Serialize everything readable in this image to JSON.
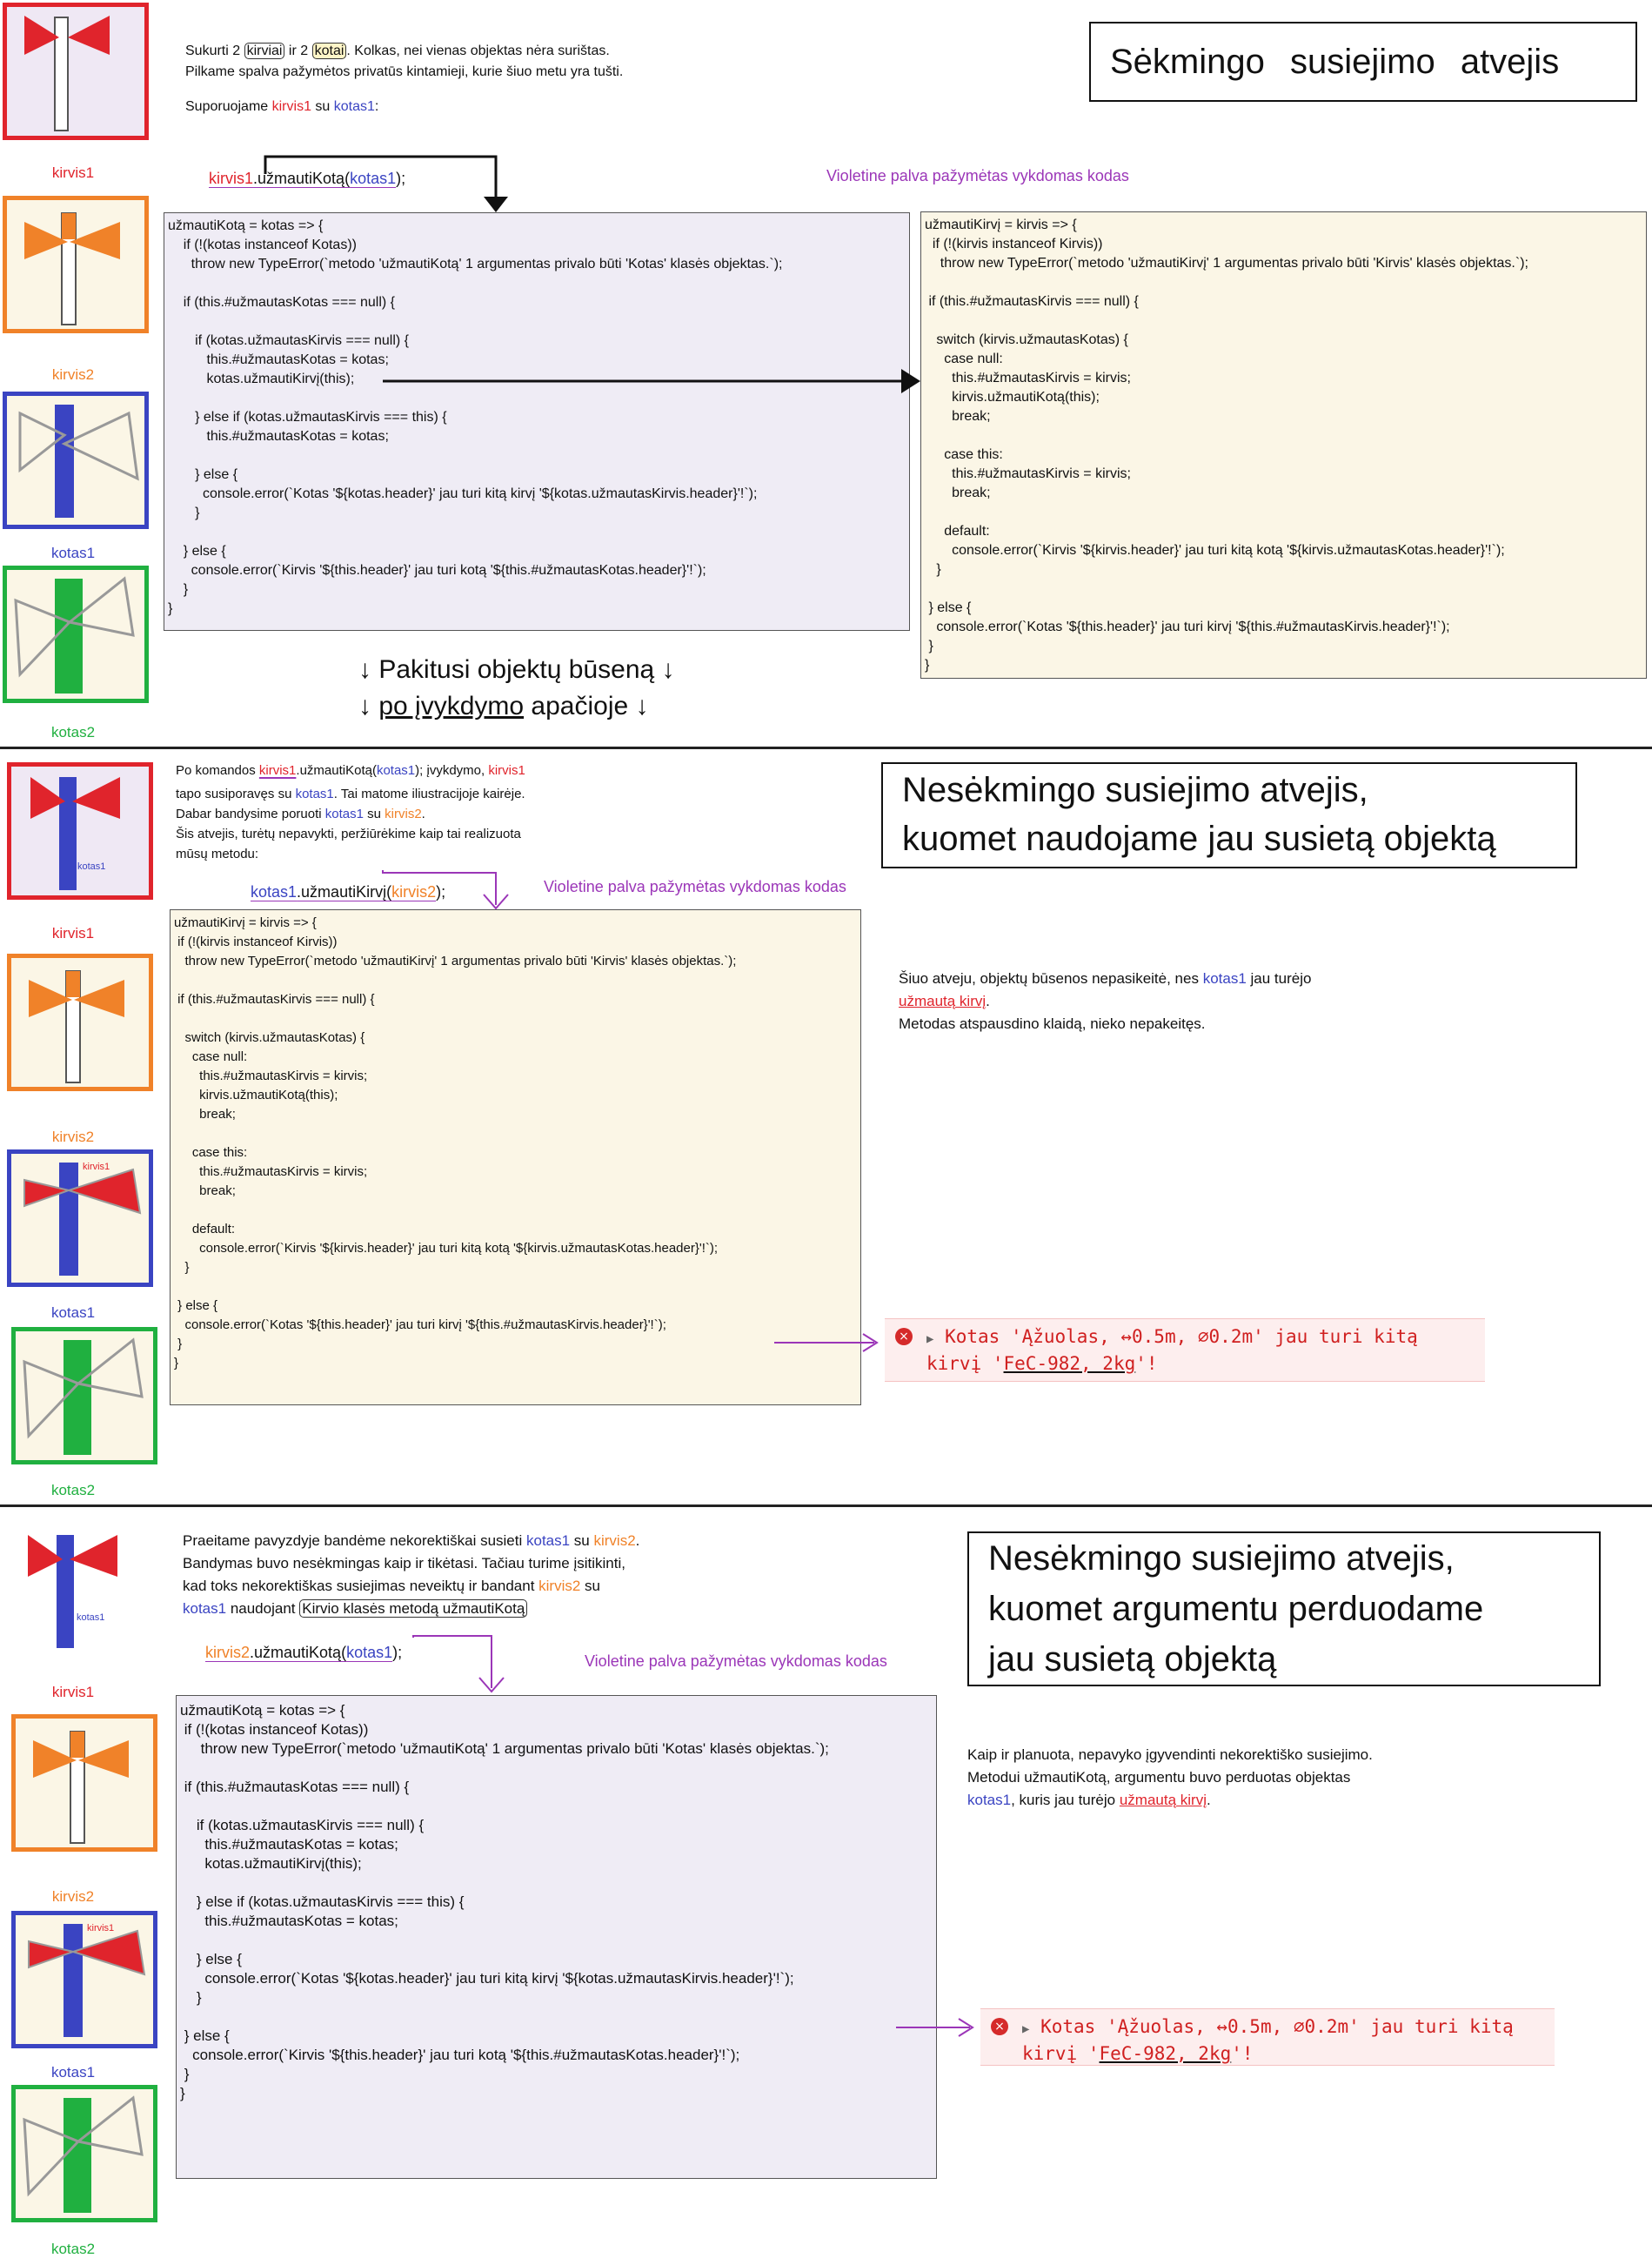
{
  "objects": {
    "kirvis1": "kirvis1",
    "kirvis2": "kirvis2",
    "kotas1": "kotas1",
    "kotas2": "kotas2",
    "inner_kotas1": "kotas1",
    "inner_kirvis1": "kirvis1"
  },
  "colors": {
    "red": "#e0242c",
    "orange": "#f08229",
    "blue": "#3a44c2",
    "green": "#20b040",
    "purple": "#9b36b8"
  },
  "s1": {
    "title": "Sėkmingo susiejimo atvejis",
    "intro": {
      "l1a": "Sukurti 2 ",
      "l1b": "kirviai",
      "l1c": " ir 2 ",
      "l1d": "kotai",
      "l1e": ". Kolkas, nei vienas objektas nėra surištas.",
      "l2": "Pilkame spalva pažymėtos privatūs kintamieji, kurie šiuo metu yra tušti.",
      "l3a": "Suporuojame ",
      "l3b": "kirvis1",
      "l3c": " su ",
      "l3d": "kotas1",
      "l3e": ":"
    },
    "call": {
      "a": "kirvis1",
      "b": ".užmautiKotą(",
      "c": "kotas1",
      "d": ");"
    },
    "note": "Violetine palva pažymėtas vykdomas kodas",
    "code_left": [
      "užmautiKotą = kotas => {",
      "    if (!(kotas instanceof Kotas))",
      "      throw new TypeError(`metodo 'užmautiKotą' 1 argumentas privalo būti 'Kotas' klasės objektas.`);",
      "",
      "    if (this.#užmautasKotas === null) {",
      "",
      "       if (kotas.užmautasKirvis === null) {",
      "          this.#užmautasKotas = kotas;",
      "          kotas.užmautiKirvį(this);",
      "",
      "       } else if (kotas.užmautasKirvis === this) {",
      "          this.#užmautasKotas = kotas;",
      "",
      "       } else {",
      "         console.error(`Kotas '${kotas.header}' jau turi kitą kirvį '${kotas.užmautasKirvis.header}'!`);",
      "       }",
      "",
      "    } else {",
      "      console.error(`Kirvis '${this.header}' jau turi kotą '${this.#užmautasKotas.header}'!`);",
      "    }",
      "}"
    ],
    "code_right": [
      "užmautiKirvį = kirvis => {",
      "  if (!(kirvis instanceof Kirvis))",
      "    throw new TypeError(`metodo 'užmautiKirvį' 1 argumentas privalo būti 'Kirvis' klasės objektas.`);",
      "",
      " if (this.#užmautasKirvis === null) {",
      "",
      "   switch (kirvis.užmautasKotas) {",
      "     case null:",
      "       this.#užmautasKirvis = kirvis;",
      "       kirvis.užmautiKotą(this);",
      "       break;",
      "",
      "     case this:",
      "       this.#užmautasKirvis = kirvis;",
      "       break;",
      "",
      "     default:",
      "       console.error(`Kirvis '${kirvis.header}' jau turi kitą kotą '${kirvis.užmautasKotas.header}'!`);",
      "   }",
      "",
      " } else {",
      "   console.error(`Kotas '${this.header}' jau turi kirvį '${this.#užmautasKirvis.header}'!`);",
      " }",
      "}"
    ],
    "mid1": "↓ Pakitusi objektų būseną ↓",
    "mid2a": "↓  ",
    "mid2b": "po įvykdymo",
    "mid2c": " apačioje  ↓"
  },
  "s2": {
    "title1": "Nesėkmingo susiejimo atvejis,",
    "title2": "kuomet naudojame jau susietą objektą",
    "intro": {
      "l1a": "Po komandos ",
      "l1b": "kirvis1",
      "l1c": ".užmautiKotą(",
      "l1d": "kotas1",
      "l1e": ");  įvykdymo,  ",
      "l1f": "kirvis1",
      "l2a": "tapo susiporavęs su ",
      "l2b": "kotas1",
      "l2c": ". Tai matome iliustracijoje kairėje.",
      "l3a": "Dabar  bandysime poruoti ",
      "l3b": "kotas1",
      "l3c": " su ",
      "l3d": "kirvis2",
      "l3e": ".",
      "l4": "Šis atvejis, turėtų nepavykti, peržiūrėkime kaip tai realizuota",
      "l5": "mūsų metodu:"
    },
    "call": {
      "a": "kotas1",
      "b": ".užmautiKirvį(",
      "c": "kirvis2",
      "d": ");"
    },
    "note": "Violetine palva pažymėtas vykdomas kodas",
    "code": [
      "užmautiKirvį = kirvis => {",
      " if (!(kirvis instanceof Kirvis))",
      "   throw new TypeError(`metodo 'užmautiKirvį' 1 argumentas privalo būti 'Kirvis' klasės objektas.`);",
      "",
      " if (this.#užmautasKirvis === null) {",
      "",
      "   switch (kirvis.užmautasKotas) {",
      "     case null:",
      "       this.#užmautasKirvis = kirvis;",
      "       kirvis.užmautiKotą(this);",
      "       break;",
      "",
      "     case this:",
      "       this.#užmautasKirvis = kirvis;",
      "       break;",
      "",
      "     default:",
      "       console.error(`Kirvis '${kirvis.header}' jau turi kitą kotą '${kirvis.užmautasKotas.header}'!`);",
      "   }",
      "",
      " } else {",
      "   console.error(`Kotas '${this.header}' jau turi kirvį '${this.#užmautasKirvis.header}'!`);",
      " }",
      "}"
    ],
    "side": {
      "l1a": "Šiuo atveju, objektų būsenos nepasikeitė, nes ",
      "l1b": "kotas1",
      "l1c": " jau turėjo",
      "l2": "užmautą kirvį",
      "l2b": ".",
      "l3": "Metodas atspausdino klaidą, nieko nepakeitęs."
    },
    "error": {
      "icon": "×",
      "tri": "▶",
      "l1": "Kotas 'Ąžuolas, ↔0.5m, ⌀0.2m' jau turi kitą",
      "l2a": "kirvį '",
      "l2b": "FeC-982, 2kg",
      "l2c": "'!"
    }
  },
  "s3": {
    "title1": "Nesėkmingo susiejimo atvejis,",
    "title2": "kuomet argumentu perduodame",
    "title3": "jau susietą objektą",
    "intro": {
      "l1a": "Praeitame pavyzdyje bandėme nekorektiškai susieti ",
      "l1b": "kotas1",
      "l1c": " su ",
      "l1d": "kirvis2",
      "l1e": ".",
      "l2": "Bandymas buvo nesėkmingas kaip ir tikėtasi. Tačiau turime įsitikinti,",
      "l3a": "kad toks nekorektiškas susiejimas neveiktų ir bandant ",
      "l3b": "kirvis2",
      "l3c": " su",
      "l4a": "kotas1",
      "l4b": " naudojant ",
      "l4c": "Kirvio klasės metodą užmautiKotą"
    },
    "call": {
      "a": "kirvis2",
      "b": ".užmautiKotą(",
      "c": "kotas1",
      "d": ");"
    },
    "note": "Violetine palva pažymėtas vykdomas kodas",
    "code": [
      "užmautiKotą = kotas => {",
      " if (!(kotas instanceof Kotas))",
      "     throw new TypeError(`metodo 'užmautiKotą' 1 argumentas privalo būti 'Kotas' klasės objektas.`);",
      "",
      " if (this.#užmautasKotas === null) {",
      "",
      "    if (kotas.užmautasKirvis === null) {",
      "      this.#užmautasKotas = kotas;",
      "      kotas.užmautiKirvį(this);",
      "",
      "    } else if (kotas.užmautasKirvis === this) {",
      "      this.#užmautasKotas = kotas;",
      "",
      "    } else {",
      "      console.error(`Kotas '${kotas.header}' jau turi kitą kirvį '${kotas.užmautasKirvis.header}'!`);",
      "    }",
      "",
      " } else {",
      "   console.error(`Kirvis '${this.header}' jau turi kotą '${this.#užmautasKotas.header}'!`);",
      " }",
      "}"
    ],
    "side": {
      "l1": "Kaip ir planuota, nepavyko įgyvendinti nekorektiško susiejimo.",
      "l2": "Metodui užmautiKotą, argumentu buvo perduotas objektas",
      "l3a": "kotas1",
      "l3b": ", kuris jau turėjo ",
      "l3c": "užmautą kirvį",
      "l3d": "."
    },
    "error": {
      "icon": "×",
      "tri": "▶",
      "l1": "Kotas 'Ąžuolas, ↔0.5m, ⌀0.2m' jau turi kitą",
      "l2a": "kirvį '",
      "l2b": "FeC-982, 2kg",
      "l2c": "'!"
    }
  }
}
